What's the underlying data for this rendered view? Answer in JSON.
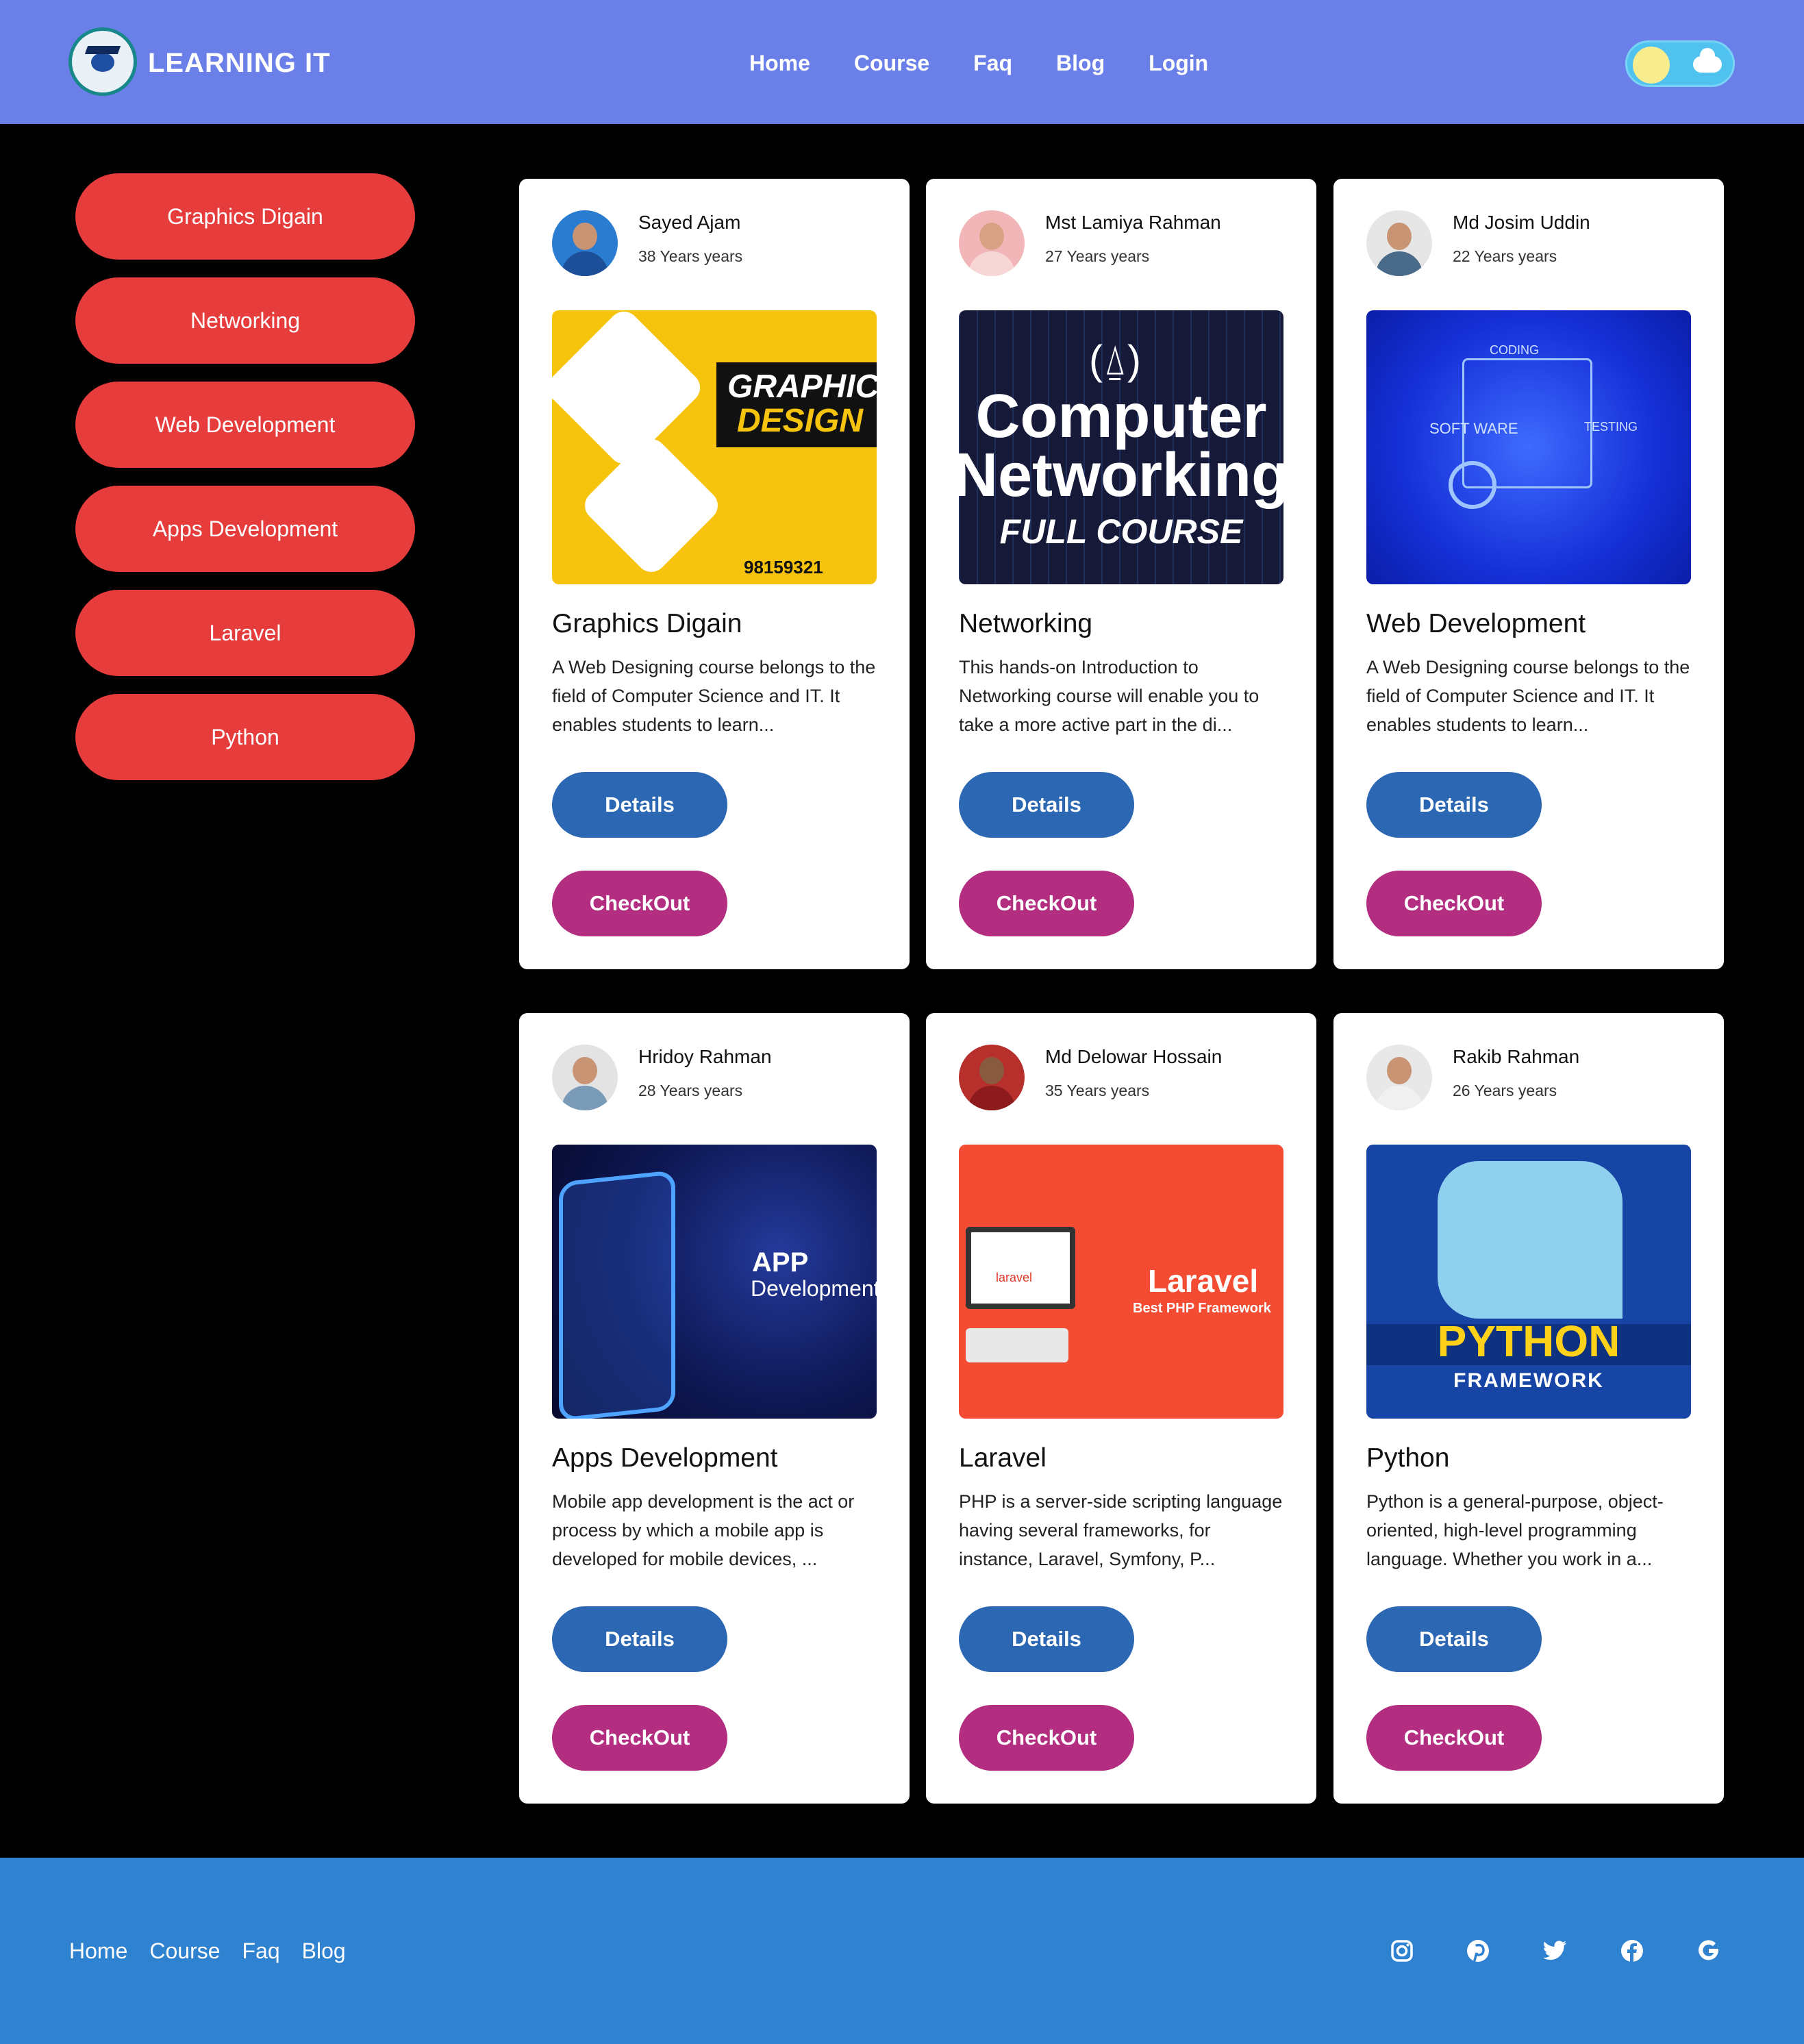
{
  "header": {
    "brand": "LEARNING IT",
    "nav": [
      "Home",
      "Course",
      "Faq",
      "Blog",
      "Login"
    ]
  },
  "sidebar": {
    "items": [
      "Graphics Digain",
      "Networking",
      "Web Development",
      "Apps Development",
      "Laravel",
      "Python"
    ]
  },
  "courses": [
    {
      "author": "Sayed Ajam",
      "age": "38 Years years",
      "title": "Graphics Digain",
      "description": "A Web Designing course belongs to the field of Computer Science and IT. It enables students to learn...",
      "image_text": [
        "GRAPHIC",
        "DESIGN",
        "98159321"
      ],
      "details": "Details",
      "checkout": "CheckOut"
    },
    {
      "author": "Mst Lamiya Rahman",
      "age": "27 Years years",
      "title": "Networking",
      "description": "This hands-on Introduction to Networking course will enable you to take a more active part in the di...",
      "image_text": [
        "(⍙)",
        "Computer",
        "Networking",
        "FULL COURSE"
      ],
      "details": "Details",
      "checkout": "CheckOut"
    },
    {
      "author": "Md Josim Uddin",
      "age": "22 Years years",
      "title": "Web Development",
      "description": "A Web Designing course belongs to the field of Computer Science and IT. It enables students to learn...",
      "image_text": [
        "CODING",
        "SOFT WARE",
        "TESTING"
      ],
      "details": "Details",
      "checkout": "CheckOut"
    },
    {
      "author": "Hridoy Rahman",
      "age": "28 Years years",
      "title": "Apps Development",
      "description": "Mobile app development is the act or process by which a mobile app is developed for mobile devices, ...",
      "image_text": [
        "APP",
        "Development"
      ],
      "details": "Details",
      "checkout": "CheckOut"
    },
    {
      "author": "Md Delowar Hossain",
      "age": "35 Years years",
      "title": "Laravel",
      "description": "PHP is a server-side scripting language having several frameworks, for instance, Laravel, Symfony, P...",
      "image_text": [
        "Laravel",
        "Best PHP Framework",
        "laravel"
      ],
      "details": "Details",
      "checkout": "CheckOut"
    },
    {
      "author": "Rakib Rahman",
      "age": "26 Years years",
      "title": "Python",
      "description": "Python is a general-purpose, object-oriented, high-level programming language. Whether you work in a...",
      "image_text": [
        "PYTHON",
        "FRAMEWORK"
      ],
      "details": "Details",
      "checkout": "CheckOut"
    }
  ],
  "footer": {
    "links": [
      "Home",
      "Course",
      "Faq",
      "Blog"
    ],
    "social_icons": [
      "instagram-icon",
      "pinterest-icon",
      "twitter-icon",
      "facebook-icon",
      "google-icon"
    ]
  },
  "colors": {
    "navbar": "#6b7fe9",
    "sidebar_button": "#e63c3c",
    "details_button": "#2b67b3",
    "checkout_button": "#b32d80",
    "footer": "#2f82cf"
  }
}
